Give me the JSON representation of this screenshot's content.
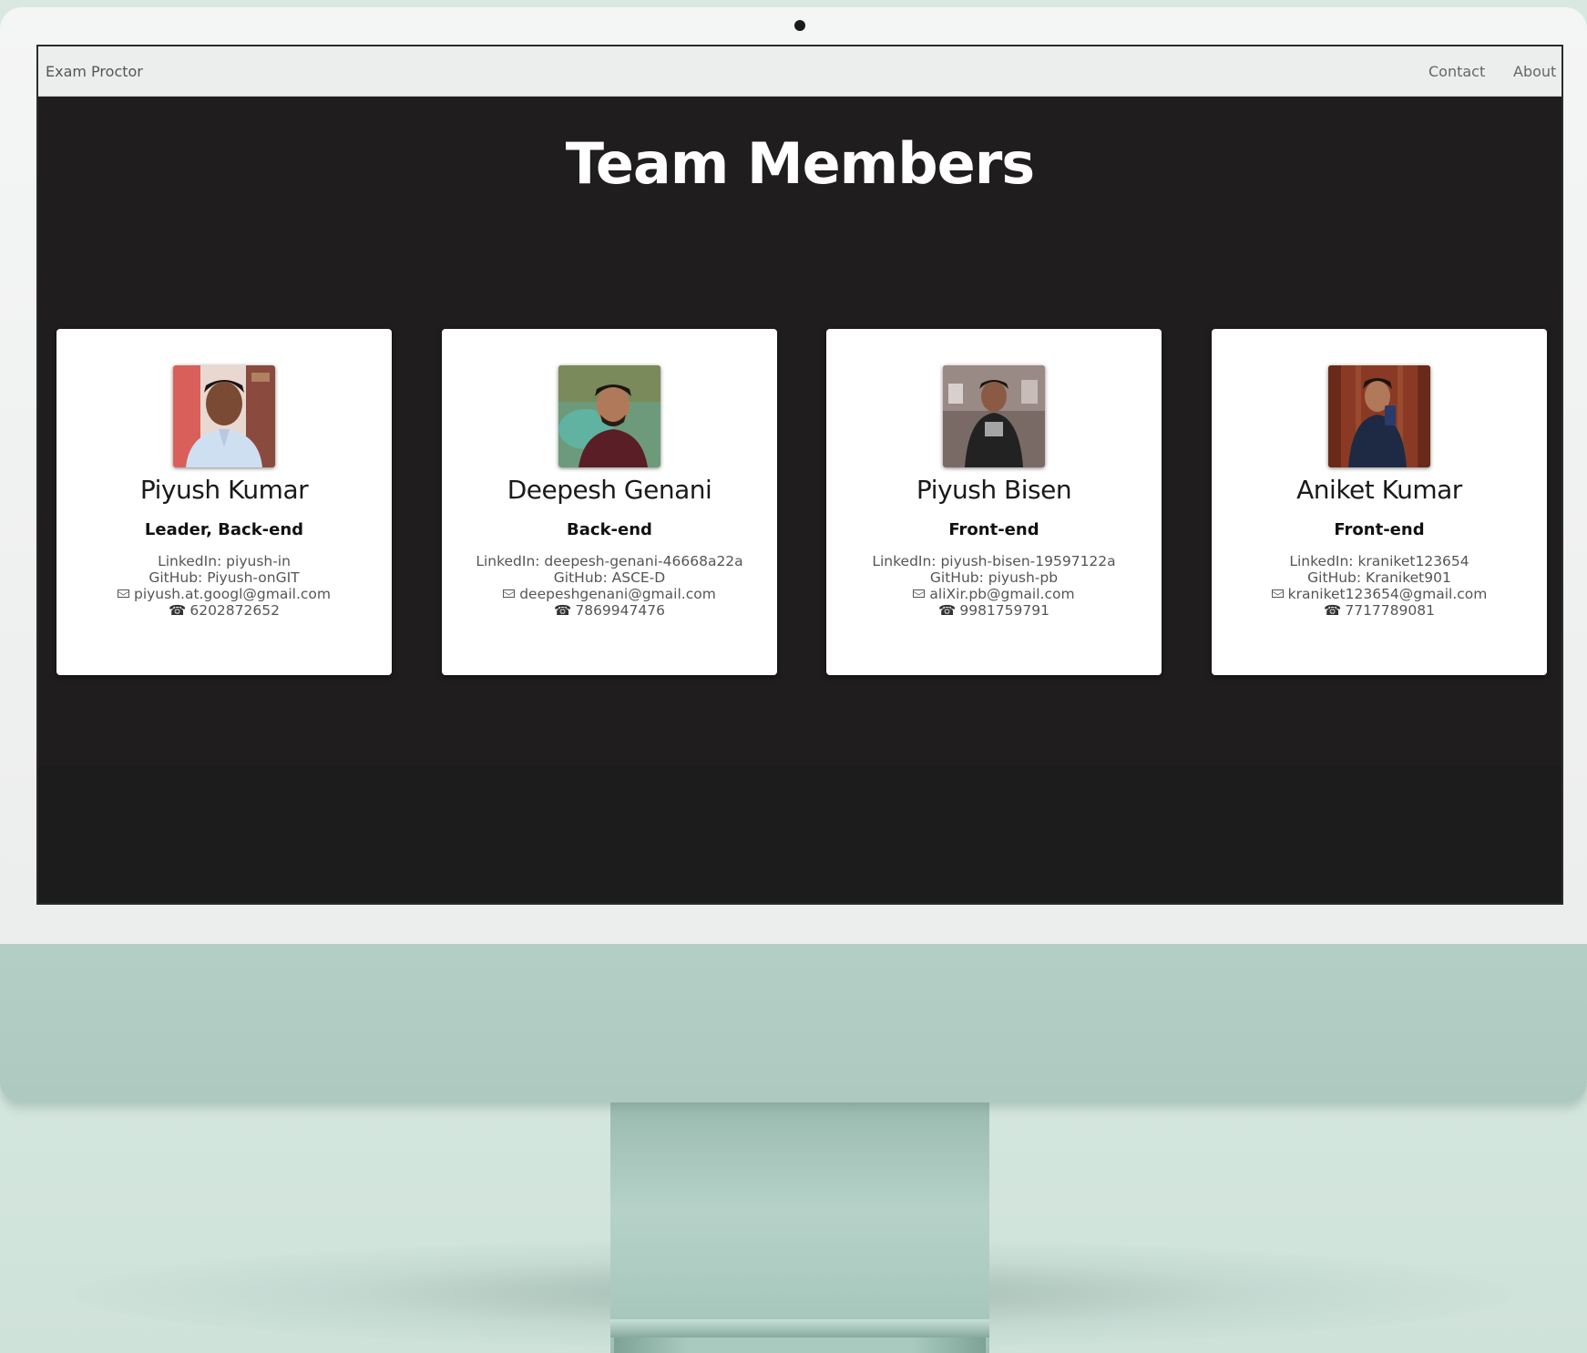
{
  "navbar": {
    "brand": "Exam Proctor",
    "links": [
      "Contact",
      "About"
    ]
  },
  "page": {
    "heading": "Team Members"
  },
  "members": [
    {
      "name": "Piyush Kumar",
      "role": "Leader, Back-end",
      "linkedin": "LinkedIn: piyush-in",
      "github": "GitHub: Piyush-onGIT",
      "email": "piyush.at.googl@gmail.com",
      "phone": "6202872652"
    },
    {
      "name": "Deepesh Genani",
      "role": "Back-end",
      "linkedin": "LinkedIn: deepesh-genani-46668a22a",
      "github": "GitHub: ASCE-D",
      "email": "deepeshgenani@gmail.com",
      "phone": "7869947476"
    },
    {
      "name": "Piyush Bisen",
      "role": "Front-end",
      "linkedin": "LinkedIn: piyush-bisen-19597122a",
      "github": "GitHub: piyush-pb",
      "email": "aliXir.pb@gmail.com",
      "phone": "9981759791"
    },
    {
      "name": "Aniket Kumar",
      "role": "Front-end",
      "linkedin": "LinkedIn: kraniket123654",
      "github": "GitHub: Kraniket901",
      "email": "kraniket123654@gmail.com",
      "phone": "7717789081"
    }
  ],
  "icons": {
    "email": "envelope-icon",
    "phone": "telephone-icon"
  },
  "colors": {
    "screen_bg": "#1f1d1e",
    "navbar_bg": "#eceeed",
    "device_body": "#b4cfc6",
    "backdrop": "#d6e8e0"
  }
}
